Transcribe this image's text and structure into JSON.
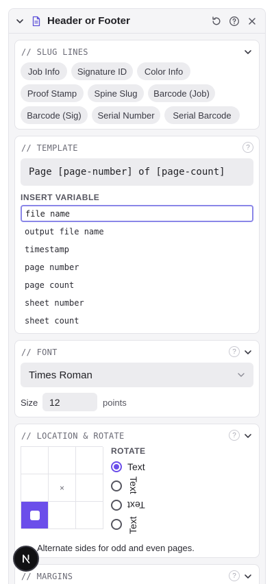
{
  "panel": {
    "title": "Header or Footer"
  },
  "slug_lines": {
    "title": "// SLUG LINES",
    "chips": [
      "Job Info",
      "Signature ID",
      "Color Info",
      "Proof Stamp",
      "Spine Slug",
      "Barcode (Job)",
      "Barcode (Sig)",
      "Serial Number",
      "Serial Barcode"
    ]
  },
  "template": {
    "title": "// TEMPLATE",
    "help": "?",
    "value": "Page [page-number] of [page-count]",
    "insert_label": "INSERT VARIABLE",
    "insert_value": "file name",
    "variables": [
      "output file name",
      "timestamp",
      "page number",
      "page count",
      "sheet number",
      "sheet count"
    ]
  },
  "font": {
    "title": "// FONT",
    "help": "?",
    "selected": "Times Roman",
    "size_label": "Size",
    "size_value": "12",
    "size_unit": "points"
  },
  "location": {
    "title": "// LOCATION & ROTATE",
    "help": "?",
    "center_mark": "×",
    "rotate_label": "ROTATE",
    "options": [
      "Text",
      "Text",
      "Text",
      "Text"
    ],
    "selected_option": 0,
    "alternate_label": "Alternate sides for odd and even pages."
  },
  "margins": {
    "title": "// MARGINS",
    "help": "?"
  },
  "colors": {
    "accent": "#6b4eea",
    "focus_border": "#8a86e8",
    "chip_bg": "#ececef"
  }
}
